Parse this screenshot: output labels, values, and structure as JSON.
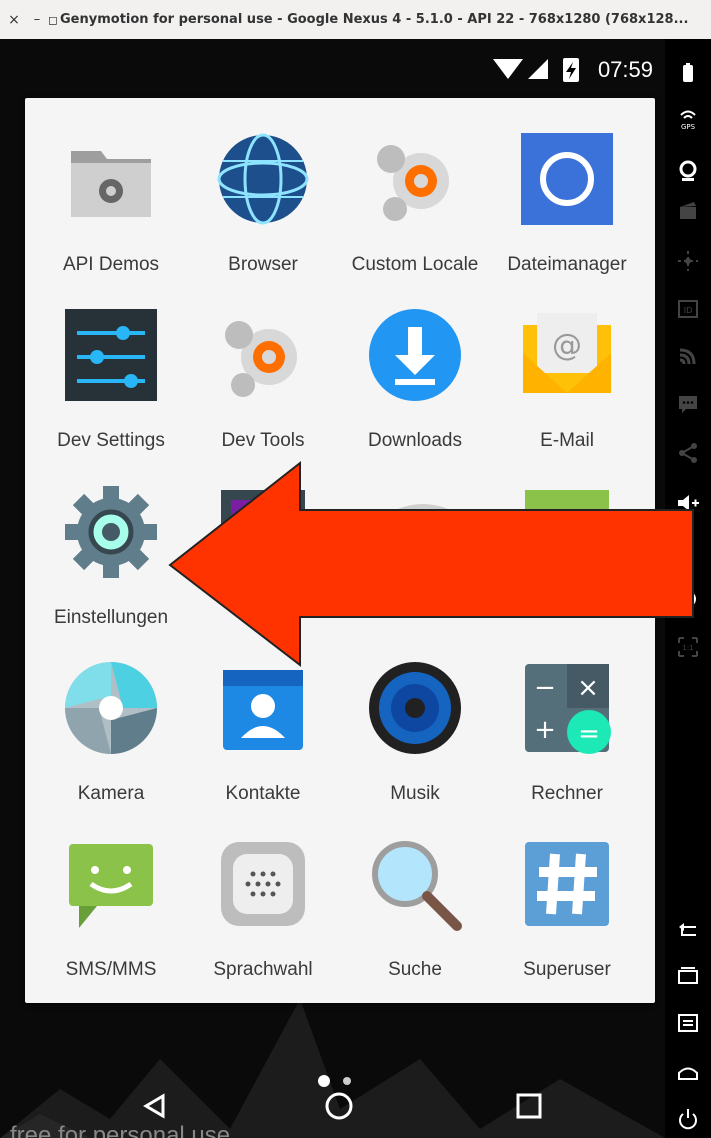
{
  "window": {
    "title": "Genymotion for personal use - Google Nexus 4 - 5.1.0 - API 22 - 768x1280 (768x128...",
    "close_glyph": "×",
    "minimize_glyph": "–",
    "window_glyph": "◻"
  },
  "status_bar": {
    "time": "07:59"
  },
  "apps": [
    {
      "label": "API Demos",
      "icon": "folder-gear-icon"
    },
    {
      "label": "Browser",
      "icon": "globe-icon"
    },
    {
      "label": "Custom Locale",
      "icon": "gears-icon"
    },
    {
      "label": "Dateimanager",
      "icon": "file-manager-icon"
    },
    {
      "label": "Dev Settings",
      "icon": "sliders-icon"
    },
    {
      "label": "Dev Tools",
      "icon": "gears-icon"
    },
    {
      "label": "Downloads",
      "icon": "download-icon"
    },
    {
      "label": "E-Mail",
      "icon": "envelope-icon"
    },
    {
      "label": "Einstellungen",
      "icon": "settings-gear-icon"
    },
    {
      "label": "",
      "icon": "gallery-icon"
    },
    {
      "label": "",
      "icon": "gestures-icon"
    },
    {
      "label": "",
      "icon": "calendar-icon"
    },
    {
      "label": "Kamera",
      "icon": "camera-shutter-icon"
    },
    {
      "label": "Kontakte",
      "icon": "contacts-icon"
    },
    {
      "label": "Musik",
      "icon": "speaker-icon"
    },
    {
      "label": "Rechner",
      "icon": "calculator-icon"
    },
    {
      "label": "SMS/MMS",
      "icon": "message-icon"
    },
    {
      "label": "Sprachwahl",
      "icon": "voice-dialer-icon"
    },
    {
      "label": "Suche",
      "icon": "magnifier-icon"
    },
    {
      "label": "Superuser",
      "icon": "hash-icon"
    }
  ],
  "watermark": "free for personal use",
  "annotation": {
    "color": "#ff3300"
  },
  "colors": {
    "drawer_bg": "#f5f5f5",
    "label": "#3a3a3a",
    "highlight_arrow": "#ff3300"
  }
}
